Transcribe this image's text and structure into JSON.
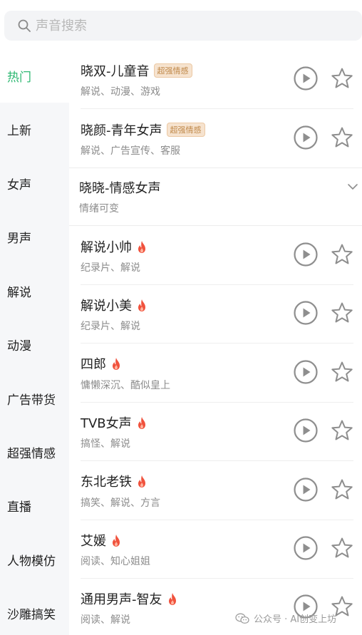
{
  "search": {
    "placeholder": "声音搜索",
    "value": ""
  },
  "sidebar": {
    "items": [
      {
        "label": "热门",
        "active": true
      },
      {
        "label": "上新"
      },
      {
        "label": "女声"
      },
      {
        "label": "男声"
      },
      {
        "label": "解说"
      },
      {
        "label": "动漫"
      },
      {
        "label": "广告带货"
      },
      {
        "label": "超强情感"
      },
      {
        "label": "直播"
      },
      {
        "label": "人物模仿"
      },
      {
        "label": "沙雕搞笑"
      }
    ]
  },
  "voices": [
    {
      "name": "晓双-儿童音",
      "tag": "超强情感",
      "desc": "解说、动漫、游戏"
    },
    {
      "name": "晓颜-青年女声",
      "tag": "超强情感",
      "desc": "解说、广告宣传、客服"
    },
    {
      "name": "晓晓-情感女声",
      "desc": "情绪可变",
      "expandable": true
    },
    {
      "name": "解说小帅",
      "hot": true,
      "desc": "纪录片、解说"
    },
    {
      "name": "解说小美",
      "hot": true,
      "desc": "纪录片、解说"
    },
    {
      "name": "四郎",
      "hot": true,
      "desc": "慵懒深沉、酷似皇上"
    },
    {
      "name": "TVB女声",
      "hot": true,
      "desc": "搞怪、解说"
    },
    {
      "name": "东北老铁",
      "hot": true,
      "desc": "搞笑、解说、方言"
    },
    {
      "name": "艾媛",
      "hot": true,
      "desc": "阅读、知心姐姐"
    },
    {
      "name": "通用男声-智友",
      "hot": true,
      "desc": "阅读、解说"
    }
  ],
  "watermark": {
    "text": "公众号 · AI创变上坊",
    "icon": "wechat-icon"
  },
  "colors": {
    "accent": "#2eb872",
    "tag_text": "#c0894a",
    "tag_bg": "#f6e3cf",
    "fire": "#f0523d"
  }
}
